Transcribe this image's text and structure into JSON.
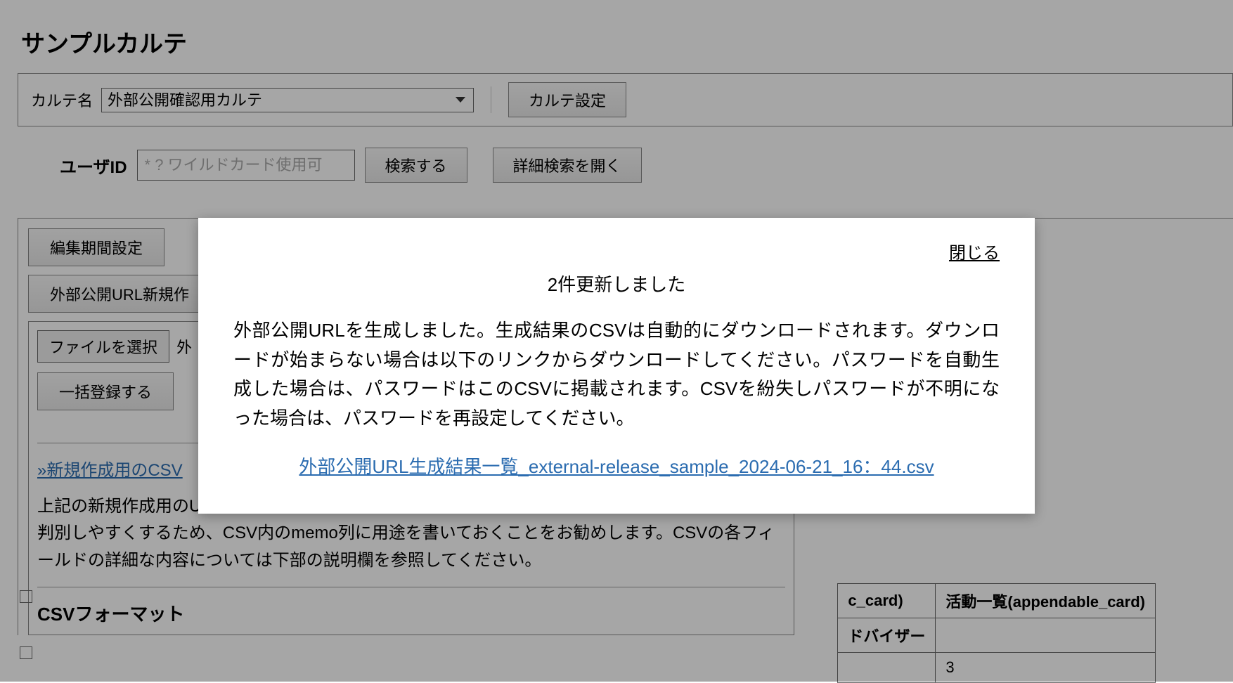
{
  "page": {
    "title": "サンプルカルテ"
  },
  "karte": {
    "label": "カルテ名",
    "selected": "外部公開確認用カルテ",
    "settings_button": "カルテ設定"
  },
  "search": {
    "user_id_label": "ユーザID",
    "user_id_placeholder": "* ? ワイルドカード使用可",
    "search_button": "検索する",
    "advanced_button": "詳細検索を開く"
  },
  "buttons": {
    "edit_period": "編集期間設定",
    "external_url_new": "外部公開URL新規作",
    "file_select": "ファイルを選択",
    "file_status_prefix": "外",
    "batch_register": "一括登録する"
  },
  "panel": {
    "csv_link": "»新規作成用のCSV",
    "description": "上記の新規作成用のURLとパスワードが外部公開URLは一人の学生に対し複数発行できます。後々判別しやすくするため、CSV内のmemo列に用途を書いておくことをお勧めします。CSVの各フィールドの詳細な内容については下部の説明欄を参照してください。",
    "csv_format_heading": "CSVフォーマット"
  },
  "table": {
    "header1": "c_card)",
    "header2": "活動一覧(appendable_card)",
    "cell1": "ドバイザー",
    "cell2": "",
    "cell3": "",
    "cell4": "3"
  },
  "modal": {
    "close": "閉じる",
    "title": "2件更新しました",
    "body": "外部公開URLを生成しました。生成結果のCSVは自動的にダウンロードされます。ダウンロードが始まらない場合は以下のリンクからダウンロードしてください。パスワードを自動生成した場合は、パスワードはこのCSVに掲載されます。CSVを紛失しパスワードが不明になった場合は、パスワードを再設定してください。",
    "link_text": "外部公開URL生成結果一覧_external-release_sample_2024-06-21_16：44.csv"
  }
}
